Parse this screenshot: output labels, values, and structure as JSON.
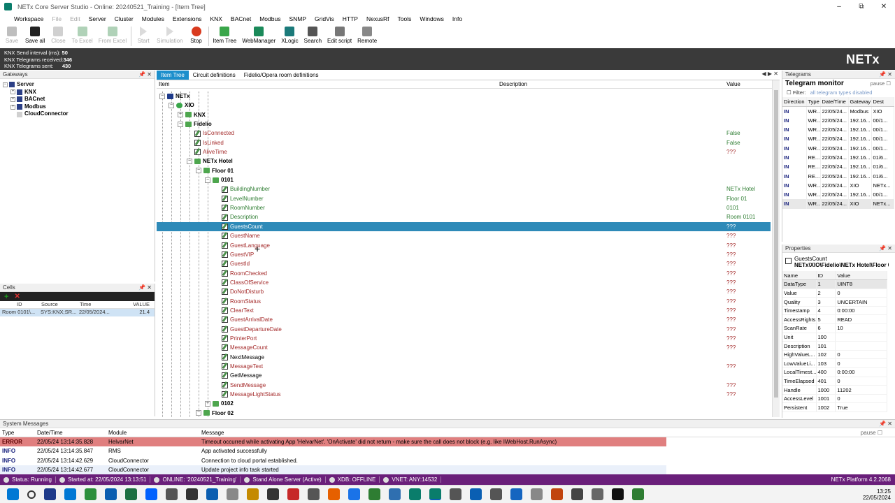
{
  "window": {
    "title": "NETx Core Server Studio - Online: 20240521_Training - [Item Tree]"
  },
  "menu": [
    "Workspace",
    "File",
    "Edit",
    "Server",
    "Cluster",
    "Modules",
    "Extensions",
    "KNX",
    "BACnet",
    "Modbus",
    "SNMP",
    "GridVis",
    "HTTP",
    "NexusRf",
    "Tools",
    "Windows",
    "Info"
  ],
  "toolbar": [
    {
      "label": "Save",
      "enabled": false,
      "color": "#444"
    },
    {
      "label": "Save all",
      "enabled": true,
      "color": "#222"
    },
    {
      "label": "Close",
      "enabled": false,
      "color": "#777"
    },
    {
      "label": "To Excel",
      "enabled": false,
      "color": "#1e7e34"
    },
    {
      "label": "From Excel",
      "enabled": false,
      "color": "#1e7e34"
    },
    {
      "label": "Start",
      "enabled": false,
      "color": "#666"
    },
    {
      "label": "Simulation",
      "enabled": false,
      "color": "#666"
    },
    {
      "label": "Stop",
      "enabled": true,
      "color": "#d93a1e"
    },
    {
      "label": "Item Tree",
      "enabled": true,
      "color": "#3aa64a"
    },
    {
      "label": "WebManager",
      "enabled": true,
      "color": "#1b8a5a"
    },
    {
      "label": "XLogic",
      "enabled": true,
      "color": "#1b7a7a"
    },
    {
      "label": "Search",
      "enabled": true,
      "color": "#555"
    },
    {
      "label": "Edit script",
      "enabled": true,
      "color": "#777"
    },
    {
      "label": "Remote",
      "enabled": true,
      "color": "#888"
    }
  ],
  "stats": {
    "send_label": "KNX Send interval (ms):",
    "send_value": "50",
    "recv_label": "KNX Telegrams received:",
    "recv_value": "346",
    "sent_label": "KNX Telegrams sent:",
    "sent_value": "430",
    "logo": "NETx"
  },
  "gateways": {
    "title": "Gateways",
    "nodes": [
      {
        "label": "Server",
        "indent": 0,
        "exp": "−",
        "color": "#2b3f86"
      },
      {
        "label": "KNX",
        "indent": 1,
        "exp": "+",
        "color": "#2b3f86"
      },
      {
        "label": "BACnet",
        "indent": 1,
        "exp": "+",
        "color": "#2b3f86"
      },
      {
        "label": "Modbus",
        "indent": 1,
        "exp": "+",
        "color": "#2b3f86"
      },
      {
        "label": "CloudConnector",
        "indent": 1,
        "exp": "",
        "color": "#d0d0d0"
      }
    ]
  },
  "cells": {
    "title": "Cells",
    "headers": [
      "ID",
      "Source",
      "Time",
      "VALUE"
    ],
    "row": [
      "Room 0101\\...",
      "SYS:KNX;SR...",
      "22/05/2024...",
      "21.4"
    ]
  },
  "itemtree": {
    "tabs": [
      "Item Tree",
      "Circuit definitions",
      "Fidelio/Opera room definitions"
    ],
    "headers": {
      "item": "Item",
      "desc": "Description",
      "value": "Value"
    },
    "rows": [
      {
        "label": "NETx",
        "lvl": 0,
        "icon": "bl",
        "exp": "−",
        "cls": "bold",
        "value": ""
      },
      {
        "label": "XIO",
        "lvl": 1,
        "icon": "gr",
        "exp": "−",
        "cls": "bold",
        "value": ""
      },
      {
        "label": "KNX",
        "lvl": 2,
        "icon": "f",
        "exp": "+",
        "cls": "bold",
        "value": ""
      },
      {
        "label": "Fidelio",
        "lvl": 2,
        "icon": "f",
        "exp": "−",
        "cls": "bold",
        "value": ""
      },
      {
        "label": "IsConnected",
        "lvl": 3,
        "icon": "p",
        "exp": "",
        "cls": "red",
        "value": "False",
        "vcls": "grn"
      },
      {
        "label": "IsLinked",
        "lvl": 3,
        "icon": "p",
        "exp": "",
        "cls": "red",
        "value": "False",
        "vcls": "grn"
      },
      {
        "label": "AliveTime",
        "lvl": 3,
        "icon": "p",
        "exp": "",
        "cls": "red",
        "value": "???",
        "vcls": "red"
      },
      {
        "label": "NETx Hotel",
        "lvl": 3,
        "icon": "f",
        "exp": "−",
        "cls": "bold",
        "value": ""
      },
      {
        "label": "Floor 01",
        "lvl": 4,
        "icon": "f",
        "exp": "−",
        "cls": "bold",
        "value": ""
      },
      {
        "label": "0101",
        "lvl": 5,
        "icon": "f",
        "exp": "−",
        "cls": "bold",
        "value": ""
      },
      {
        "label": "BuildingNumber",
        "lvl": 6,
        "icon": "p",
        "exp": "",
        "cls": "grn",
        "value": "NETx Hotel",
        "vcls": "grn"
      },
      {
        "label": "LevelNumber",
        "lvl": 6,
        "icon": "p",
        "exp": "",
        "cls": "grn",
        "value": "Floor 01",
        "vcls": "grn"
      },
      {
        "label": "RoomNumber",
        "lvl": 6,
        "icon": "p",
        "exp": "",
        "cls": "grn",
        "value": "0101",
        "vcls": "grn"
      },
      {
        "label": "Description",
        "lvl": 6,
        "icon": "p",
        "exp": "",
        "cls": "grn",
        "value": "Room 0101",
        "vcls": "grn"
      },
      {
        "label": "GuestsCount",
        "lvl": 6,
        "icon": "p",
        "exp": "",
        "cls": "sel",
        "value": "???",
        "vcls": ""
      },
      {
        "label": "GuestName",
        "lvl": 6,
        "icon": "p",
        "exp": "",
        "cls": "red",
        "value": "???",
        "vcls": "red"
      },
      {
        "label": "GuestLanguage",
        "lvl": 6,
        "icon": "p",
        "exp": "",
        "cls": "red",
        "value": "???",
        "vcls": "red"
      },
      {
        "label": "GuestVIP",
        "lvl": 6,
        "icon": "p",
        "exp": "",
        "cls": "red",
        "value": "???",
        "vcls": "red"
      },
      {
        "label": "GuestId",
        "lvl": 6,
        "icon": "p",
        "exp": "",
        "cls": "red",
        "value": "???",
        "vcls": "red"
      },
      {
        "label": "RoomChecked",
        "lvl": 6,
        "icon": "p",
        "exp": "",
        "cls": "red",
        "value": "???",
        "vcls": "red"
      },
      {
        "label": "ClassOfService",
        "lvl": 6,
        "icon": "p",
        "exp": "",
        "cls": "red",
        "value": "???",
        "vcls": "red"
      },
      {
        "label": "DoNotDisturb",
        "lvl": 6,
        "icon": "p",
        "exp": "",
        "cls": "red",
        "value": "???",
        "vcls": "red"
      },
      {
        "label": "RoomStatus",
        "lvl": 6,
        "icon": "p",
        "exp": "",
        "cls": "red",
        "value": "???",
        "vcls": "red"
      },
      {
        "label": "ClearText",
        "lvl": 6,
        "icon": "p",
        "exp": "",
        "cls": "red",
        "value": "???",
        "vcls": "red"
      },
      {
        "label": "GuestArrivalDate",
        "lvl": 6,
        "icon": "p",
        "exp": "",
        "cls": "red",
        "value": "???",
        "vcls": "red"
      },
      {
        "label": "GuestDepartureDate",
        "lvl": 6,
        "icon": "p",
        "exp": "",
        "cls": "red",
        "value": "???",
        "vcls": "red"
      },
      {
        "label": "PrinterPort",
        "lvl": 6,
        "icon": "p",
        "exp": "",
        "cls": "red",
        "value": "???",
        "vcls": "red"
      },
      {
        "label": "MessageCount",
        "lvl": 6,
        "icon": "p",
        "exp": "",
        "cls": "red",
        "value": "???",
        "vcls": "red"
      },
      {
        "label": "NextMessage",
        "lvl": 6,
        "icon": "p",
        "exp": "",
        "cls": "",
        "value": "",
        "vcls": ""
      },
      {
        "label": "MessageText",
        "lvl": 6,
        "icon": "p",
        "exp": "",
        "cls": "red",
        "value": "???",
        "vcls": "red"
      },
      {
        "label": "GetMessage",
        "lvl": 6,
        "icon": "p",
        "exp": "",
        "cls": "",
        "value": "",
        "vcls": ""
      },
      {
        "label": "SendMessage",
        "lvl": 6,
        "icon": "p",
        "exp": "",
        "cls": "red",
        "value": "???",
        "vcls": "red"
      },
      {
        "label": "MessageLightStatus",
        "lvl": 6,
        "icon": "p",
        "exp": "",
        "cls": "red",
        "value": "???",
        "vcls": "red"
      },
      {
        "label": "0102",
        "lvl": 5,
        "icon": "f",
        "exp": "+",
        "cls": "bold",
        "value": ""
      },
      {
        "label": "Floor 02",
        "lvl": 4,
        "icon": "f",
        "exp": "−",
        "cls": "bold",
        "value": ""
      }
    ]
  },
  "telegram": {
    "panel": "Telegrams",
    "title": "Telegram monitor",
    "pause": "pause",
    "filter": "Filter:",
    "filter_link": "all telegram types disabled",
    "headers": [
      "Direction",
      "Type",
      "Date/Time",
      "Gateway",
      "Dest"
    ],
    "rows": [
      [
        "IN",
        "WR...",
        "22/05/24...",
        "Modbus",
        "XIO"
      ],
      [
        "IN",
        "WR...",
        "22/05/24...",
        "192.16...",
        "00/1..."
      ],
      [
        "IN",
        "WR...",
        "22/05/24...",
        "192.16...",
        "00/1..."
      ],
      [
        "IN",
        "WR...",
        "22/05/24...",
        "192.16...",
        "00/1..."
      ],
      [
        "IN",
        "WR...",
        "22/05/24...",
        "192.16...",
        "00/1..."
      ],
      [
        "IN",
        "RE...",
        "22/05/24...",
        "192.16...",
        "01/6..."
      ],
      [
        "IN",
        "RE...",
        "22/05/24...",
        "192.16...",
        "01/6..."
      ],
      [
        "IN",
        "RE...",
        "22/05/24...",
        "192.16...",
        "01/6..."
      ],
      [
        "IN",
        "WR...",
        "22/05/24...",
        "XIO",
        "NETx..."
      ],
      [
        "IN",
        "WR...",
        "22/05/24...",
        "192.16...",
        "00/1..."
      ],
      [
        "IN",
        "WR...",
        "22/05/24...",
        "XIO",
        "NETx..."
      ]
    ]
  },
  "properties": {
    "panel": "Properties",
    "item": "GuestsCount",
    "path": "NETx\\XIO\\Fidelio\\NETx Hotel\\Floor 0",
    "headers": [
      "Name",
      "ID",
      "Value"
    ],
    "rows": [
      [
        "DataType",
        "1",
        "UINT8"
      ],
      [
        "Value",
        "2",
        "0"
      ],
      [
        "Quality",
        "3",
        "UNCERTAIN"
      ],
      [
        "Timestamp",
        "4",
        "0:00:00"
      ],
      [
        "AccessRights",
        "5",
        "READ"
      ],
      [
        "ScanRate",
        "6",
        "10"
      ],
      [
        "Unit",
        "100",
        ""
      ],
      [
        "Description",
        "101",
        ""
      ],
      [
        "HighValueL...",
        "102",
        "0"
      ],
      [
        "LowValueLi...",
        "103",
        "0"
      ],
      [
        "LocalTimest...",
        "400",
        "0:00:00"
      ],
      [
        "TimeElapsed",
        "401",
        "0"
      ],
      [
        "Handle",
        "1000",
        "11202"
      ],
      [
        "AccessLevel",
        "1001",
        "0"
      ],
      [
        "Persistent",
        "1002",
        "True"
      ]
    ]
  },
  "sysmsg": {
    "title": "System Messages",
    "pause": "pause",
    "headers": [
      "Type",
      "Date/Time",
      "Module",
      "Message"
    ],
    "rows": [
      {
        "type": "ERROR",
        "time": "22/05/24 13:14:35.828",
        "module": "HelvarNet",
        "msg": "Timeout occurred while activating App 'HelvarNet'. 'OnActivate' did not return - make sure the call does not block (e.g. like IWebHost.RunAsync)",
        "cls": "err"
      },
      {
        "type": "INFO",
        "time": "22/05/24 13:14:35.847",
        "module": "RMS",
        "msg": "App activated successfully",
        "cls": "info"
      },
      {
        "type": "INFO",
        "time": "22/05/24 13:14:42.629",
        "module": "CloudConnector",
        "msg": "Connection to cloud portal established.",
        "cls": "info"
      },
      {
        "type": "INFO",
        "time": "22/05/24 13:14:42.677",
        "module": "CloudConnector",
        "msg": "Update project info task started",
        "cls": "alt"
      }
    ]
  },
  "status": {
    "items": [
      "Status: Running",
      "Started at: 22/05/2024 13:13:51",
      "ONLINE: '20240521_Training'",
      "Stand Alone Server (Active)",
      "XDB: OFFLINE",
      "VNET: ANY:14532"
    ],
    "platform": "NETx Platform 4.2.2068"
  },
  "taskbar": {
    "apps": [
      "#1e3a8a",
      "#0078d4",
      "#2c8f3c",
      "#0b5eb0",
      "#1d6f42",
      "#0061fe",
      "#555",
      "#333",
      "#0b5eb0",
      "#888",
      "#c48a00",
      "#333",
      "#c62828",
      "#555",
      "#e66000",
      "#1a73e8",
      "#2e7d32",
      "#2f6fb0",
      "#0a7d6b",
      "#0a7d6b",
      "#555",
      "#0a5fb3",
      "#555",
      "#1565c0",
      "#888",
      "#c1440e",
      "#444",
      "#666",
      "#111",
      "#2e7d32"
    ],
    "time": "13:25",
    "date": "22/05/2024"
  },
  "colors": {
    "accent": "#2e8ab8",
    "statusbar": "#6a1f7a",
    "error_row": "#e07f7f"
  }
}
